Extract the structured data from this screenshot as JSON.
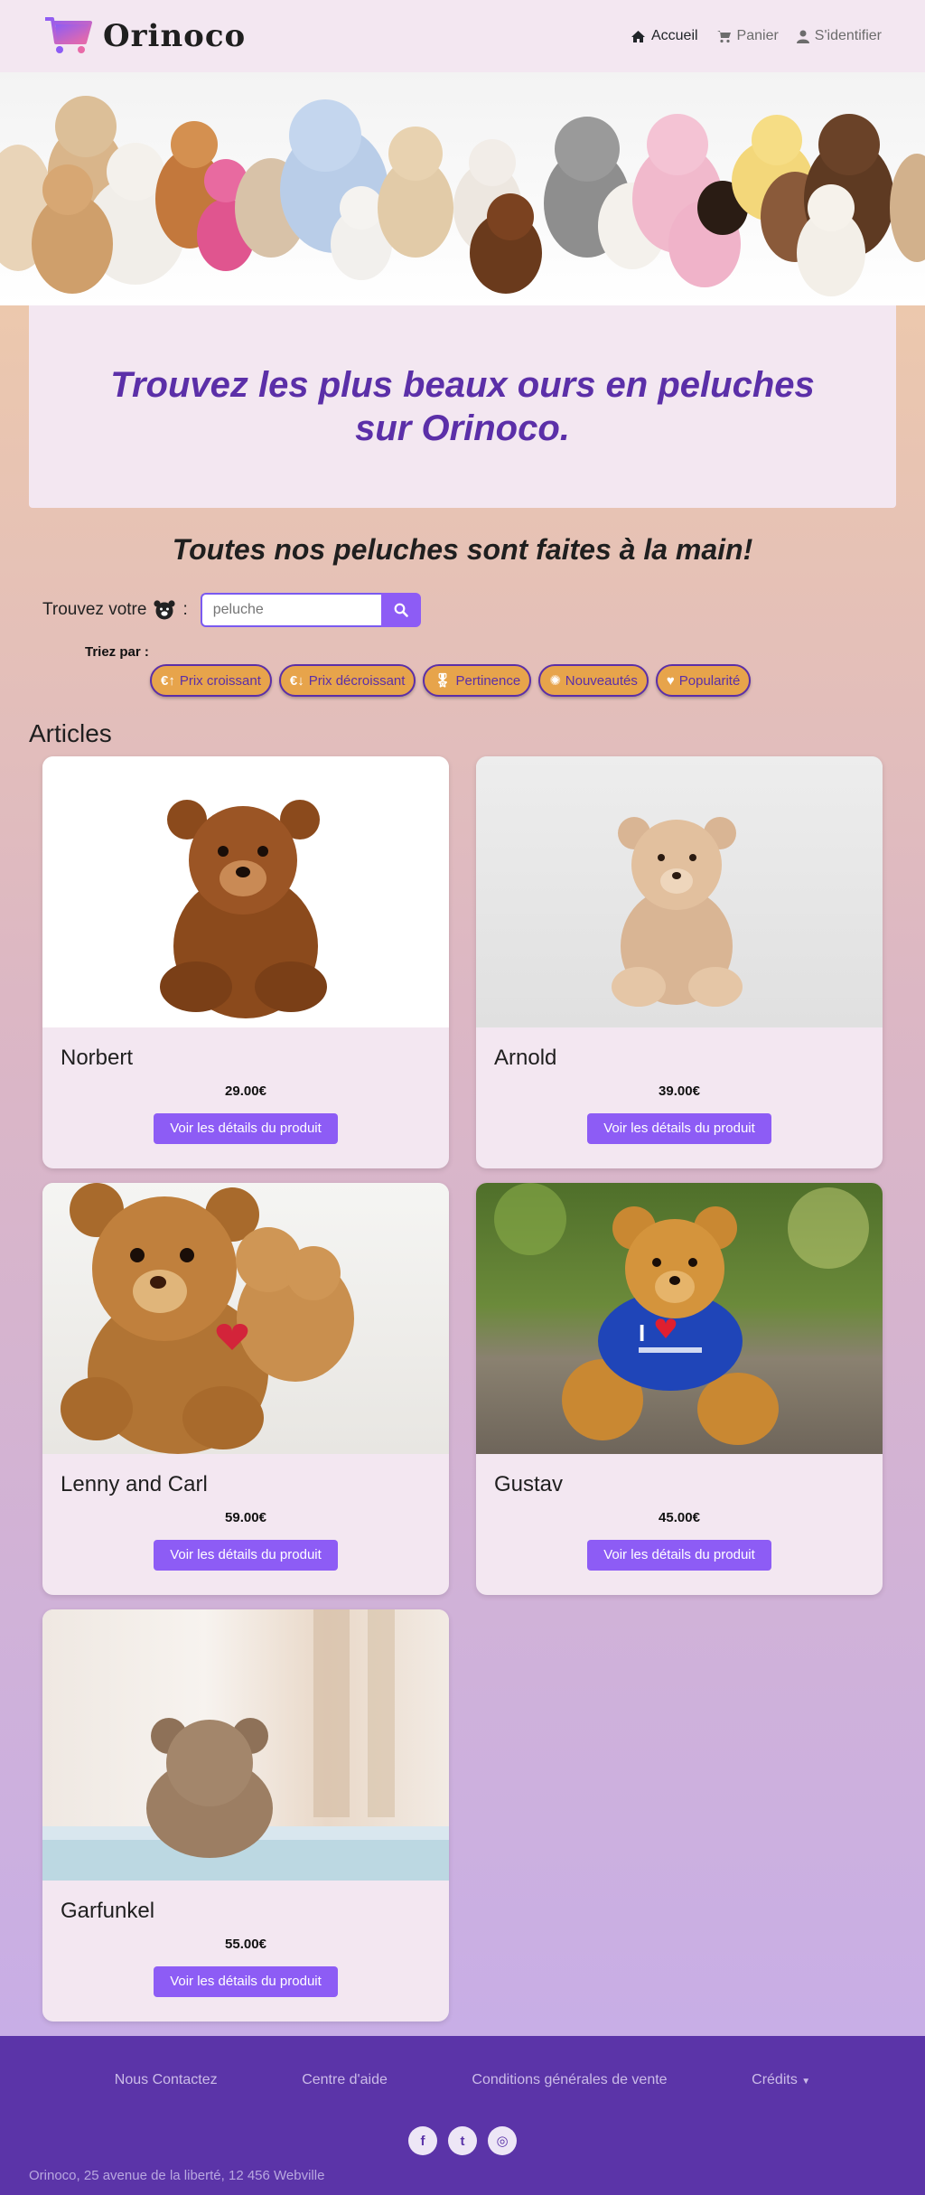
{
  "navbar": {
    "brand": "Orinoco",
    "links": [
      {
        "label": "Accueil",
        "icon": "home-icon"
      },
      {
        "label": "Panier",
        "icon": "cart-icon"
      },
      {
        "label": "S'identifier",
        "icon": "user-icon"
      }
    ]
  },
  "hero": {
    "headline": "Trouvez les plus beaux ours en peluches sur Orinoco.",
    "subtitle": "Toutes nos peluches sont faites à la main!"
  },
  "search": {
    "label": "Trouvez votre",
    "placeholder": "peluche",
    "icon": "bear-face-icon"
  },
  "sort": {
    "label": "Triez par :",
    "options": [
      {
        "label": "Prix croissant",
        "icon": "€↑"
      },
      {
        "label": "Prix décroissant",
        "icon": "€↓"
      },
      {
        "label": "Pertinence",
        "icon": "🎖"
      },
      {
        "label": "Nouveautés",
        "icon": "✺"
      },
      {
        "label": "Popularité",
        "icon": "♥"
      }
    ]
  },
  "articles": {
    "title": "Articles",
    "button_label": "Voir les détails du produit",
    "items": [
      {
        "name": "Norbert",
        "price": "29.00€"
      },
      {
        "name": "Arnold",
        "price": "39.00€"
      },
      {
        "name": "Lenny and Carl",
        "price": "59.00€"
      },
      {
        "name": "Gustav",
        "price": "45.00€"
      },
      {
        "name": "Garfunkel",
        "price": "55.00€"
      }
    ]
  },
  "footer": {
    "links": [
      "Nous Contactez",
      "Centre d'aide",
      "Conditions générales de vente",
      "Crédits"
    ],
    "social": [
      "f",
      "t",
      "◎"
    ],
    "address": "Orinoco, 25 avenue de la liberté, 12 456 Webville"
  },
  "colors": {
    "accent": "#8d5cf5",
    "brand_purple": "#5b2fa8",
    "sort_orange": "#e7a44b",
    "footer": "#5b34a8"
  }
}
